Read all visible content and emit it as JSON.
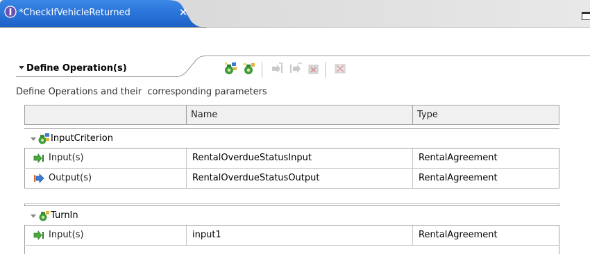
{
  "editor_tab": {
    "title": "*CheckIfVehicleReturned",
    "close_glyph": "✕"
  },
  "section": {
    "title": "Define Operation(s)",
    "description": "Define Operations and their  corresponding parameters",
    "toolbar": [
      {
        "icon": "add-request-response-operation-icon",
        "enabled": true
      },
      {
        "icon": "add-one-way-operation-icon",
        "enabled": true
      },
      {
        "icon": "add-input-icon",
        "enabled": false
      },
      {
        "icon": "add-output-icon",
        "enabled": false
      },
      {
        "icon": "add-fault-icon",
        "enabled": false
      },
      {
        "icon": "delete-icon",
        "enabled": false
      }
    ]
  },
  "table": {
    "columns": [
      "",
      "Name",
      "Type"
    ],
    "operations": [
      {
        "name": "InputCriterion",
        "icon": "request-response-operation-icon",
        "parameters": [
          {
            "kind": "Input(s)",
            "icon": "input-icon",
            "name": "RentalOverdueStatusInput",
            "type": "RentalAgreement"
          },
          {
            "kind": "Output(s)",
            "icon": "output-icon",
            "name": "RentalOverdueStatusOutput",
            "type": "RentalAgreement"
          }
        ]
      },
      {
        "name": "TurnIn",
        "icon": "one-way-operation-icon",
        "parameters": [
          {
            "kind": "Input(s)",
            "icon": "input-icon",
            "name": "input1",
            "type": "RentalAgreement"
          }
        ]
      }
    ]
  },
  "colors": {
    "tab_active": "#1e6fd8",
    "tab_gradient_end": "#c8c8c8",
    "header_bg": "#f0f0f0",
    "grid": "#a0a0a0"
  }
}
